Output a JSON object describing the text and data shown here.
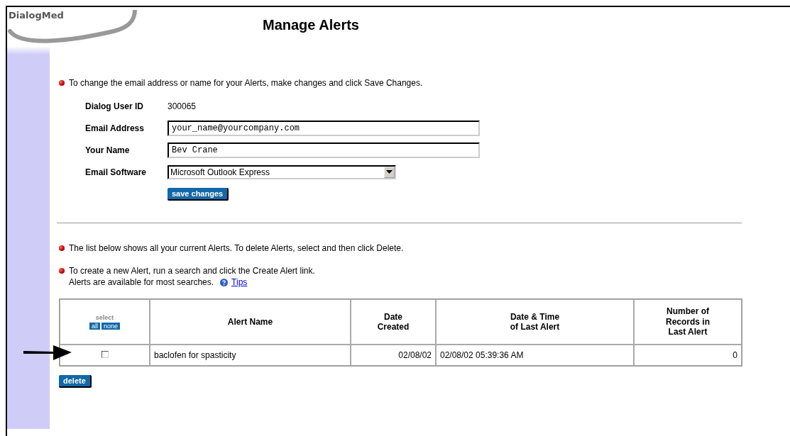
{
  "logo": "DialogMed",
  "title": "Manage Alerts",
  "intro": "To change the email address or name for your Alerts, make changes and click Save Changes.",
  "form": [
    {
      "kind": "static",
      "label": "Dialog User ID",
      "value": "300065"
    },
    {
      "kind": "input",
      "label": "Email Address",
      "value": "your_name@yourcompany.com"
    },
    {
      "kind": "input",
      "label": "Your Name",
      "value": "Bev Crane"
    },
    {
      "kind": "select",
      "label": "Email Software",
      "value": "Microsoft Outlook Express"
    }
  ],
  "save_button": "save changes",
  "notes": [
    "The list below shows all your current Alerts. To delete Alerts, select and then click Delete."
  ],
  "create_note": {
    "line1": "To create a new Alert, run a search and click the Create Alert link.",
    "line2": "Alerts are available for most searches.",
    "link": "Tips"
  },
  "table": {
    "select_header": {
      "label": "select",
      "all": "all",
      "none": "none"
    },
    "columns": [
      "Alert Name",
      "Date\nCreated",
      "Date & Time\nof Last Alert",
      "Number of\nRecords in\nLast Alert"
    ],
    "rows": [
      {
        "checked": false,
        "name": "baclofen for spasticity",
        "created": "02/08/02",
        "last_alert": "02/08/02 05:39:36 AM",
        "records": "0"
      }
    ]
  },
  "delete_button": "delete"
}
